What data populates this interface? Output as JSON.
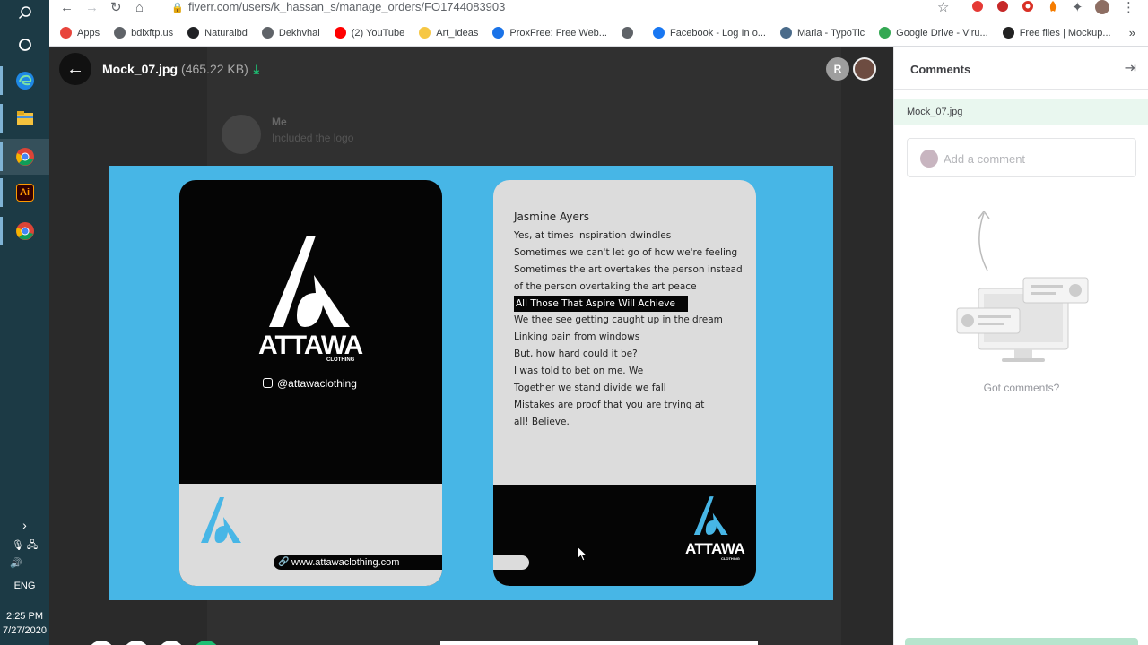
{
  "browser": {
    "url_host": "fiverr.com",
    "url_path": "/users/k_hassan_s/manage_orders/FO1744083903",
    "bookmarks": [
      {
        "label": "Apps",
        "color": "#e8453c"
      },
      {
        "label": "bdixftp.us",
        "color": "#5f6368"
      },
      {
        "label": "Naturalbd",
        "color": "#202124"
      },
      {
        "label": "Dekhvhai",
        "color": "#5f6368"
      },
      {
        "label": "(2) YouTube",
        "color": "#ff0000"
      },
      {
        "label": "Art_Ideas",
        "color": "#f6c744"
      },
      {
        "label": "ProxFree: Free Web...",
        "color": "#1a73e8"
      },
      {
        "label": "",
        "color": "#5f6368"
      },
      {
        "label": "Facebook - Log In o...",
        "color": "#1877f2"
      },
      {
        "label": "Marla - TypoTic",
        "color": "#4a6b8a"
      },
      {
        "label": "Google Drive - Viru...",
        "color": "#34a853"
      },
      {
        "label": "Free files | Mockup...",
        "color": "#222222"
      }
    ]
  },
  "taskbar": {
    "language": "ENG",
    "time": "2:25 PM",
    "date": "7/27/2020"
  },
  "viewer": {
    "file_name": "Mock_07.jpg",
    "file_size": "(465.22 KB)",
    "avatar_initial": "R",
    "background_message": {
      "author": "Me",
      "text": "Included the logo"
    }
  },
  "mockup": {
    "front": {
      "brand": "ATTAWA",
      "sub": "CLOTHING",
      "instagram": "@attawaclothing",
      "website": "www.attawaclothing.com"
    },
    "back": {
      "name": "Jasmine Ayers",
      "lines": [
        "Yes, at times inspiration dwindles",
        "Sometimes we can't let go of how we're feeling",
        "Sometimes the art overtakes the person instead",
        "of the person overtaking the art peace",
        "All Those That Aspire Will Achieve",
        "We thee see getting caught up in the dream",
        "Linking pain from windows",
        "But, how hard could it be?",
        "I was told to bet on me. We",
        "Together we stand divide we fall",
        "Mistakes are proof that you are trying at",
        "all! Believe."
      ],
      "highlight_index": 4,
      "brand": "ATTAWA",
      "sub": "CLOTHING"
    }
  },
  "comments": {
    "title": "Comments",
    "file_chip": "Mock_07.jpg",
    "input_placeholder": "Add a comment",
    "empty_text": "Got comments?"
  },
  "colors": {
    "accent": "#1dbf73",
    "mockup_bg": "#47b6e6",
    "brand_blue": "#47b6e6"
  }
}
